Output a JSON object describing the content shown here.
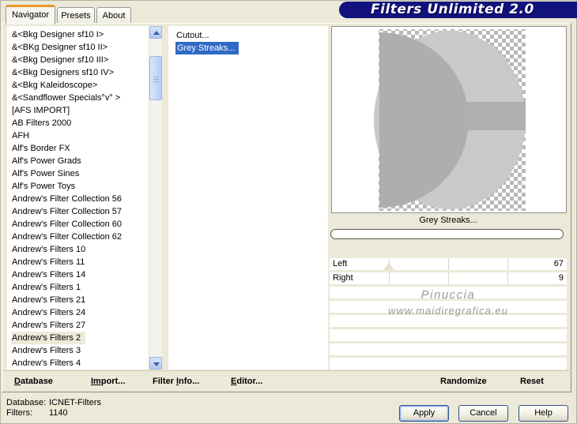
{
  "window": {
    "title": "Filters Unlimited 2.0"
  },
  "tabs": [
    {
      "label": "Navigator"
    },
    {
      "label": "Presets"
    },
    {
      "label": "About"
    }
  ],
  "category_list": {
    "items": [
      "&<Bkg Designer sf10 I>",
      "&<BKg Designer sf10 II>",
      "&<Bkg Designer sf10 III>",
      "&<Bkg Designers sf10 IV>",
      "&<Bkg Kaleidoscope>",
      "&<Sandflower Specials°v° >",
      "[AFS IMPORT]",
      "AB Filters 2000",
      "AFH",
      "Alf's Border FX",
      "Alf's Power Grads",
      "Alf's Power Sines",
      "Alf's Power Toys",
      "Andrew's Filter Collection 56",
      "Andrew's Filter Collection 57",
      "Andrew's Filter Collection 60",
      "Andrew's Filter Collection 62",
      "Andrew's Filters 10",
      "Andrew's Filters 11",
      "Andrew's Filters 14",
      "Andrew's Filters 1",
      "Andrew's Filters 21",
      "Andrew's Filters 24",
      "Andrew's Filters 27",
      "Andrew's Filters 2",
      "Andrew's Filters 3",
      "Andrew's Filters 4"
    ],
    "selected": "Andrew's Filters 2"
  },
  "filter_list": {
    "items": [
      "Cutout...",
      "Grey Streaks..."
    ],
    "selected": "Grey Streaks..."
  },
  "preview": {
    "caption": "Grey Streaks...",
    "progress_percent": 0
  },
  "sliders": [
    {
      "label": "Left",
      "value": "67"
    },
    {
      "label": "Right",
      "value": "9"
    }
  ],
  "watermark": {
    "line1": "Pinuccia",
    "line2": "www.maidiregrafica.eu"
  },
  "command_bar": [
    {
      "pre": "",
      "u": "D",
      "post": "atabase"
    },
    {
      "pre": "",
      "u": "Im",
      "post": "port..."
    },
    {
      "pre": "Filter ",
      "u": "I",
      "post": "nfo..."
    },
    {
      "pre": "",
      "u": "E",
      "post": "ditor..."
    },
    {
      "pre": "Randomize",
      "u": "",
      "post": ""
    },
    {
      "pre": "Reset",
      "u": "",
      "post": ""
    }
  ],
  "status": {
    "rows": [
      {
        "label": "Database:",
        "value": "ICNET-Filters"
      },
      {
        "label": "Filters:",
        "value": "1140"
      }
    ]
  },
  "action_buttons": [
    {
      "label": "Apply"
    },
    {
      "label": "Cancel"
    },
    {
      "label": "Help"
    }
  ],
  "colors": {
    "background": "#ECE9D8",
    "selection_blue": "#316AC5",
    "banner_navy": "#12127D",
    "tab_accent_orange": "#E7972F"
  }
}
